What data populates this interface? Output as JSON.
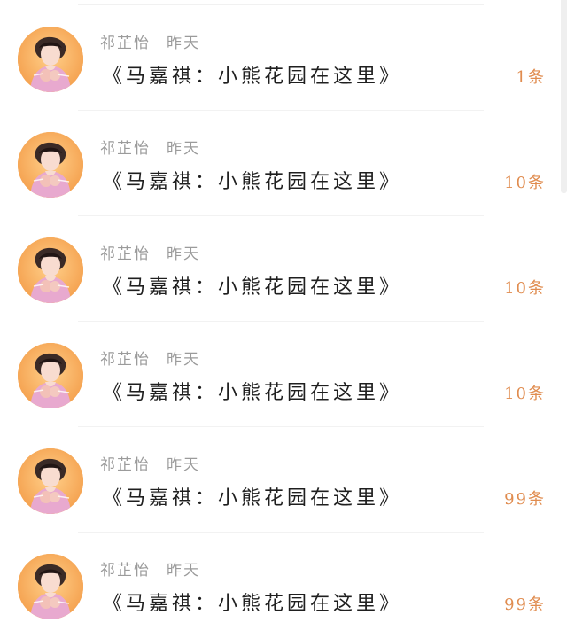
{
  "items": [
    {
      "author": "祁芷怡",
      "time": "昨天",
      "title": "《马嘉祺：小熊花园在这里》",
      "count": "1条"
    },
    {
      "author": "祁芷怡",
      "time": "昨天",
      "title": "《马嘉祺：小熊花园在这里》",
      "count": "10条"
    },
    {
      "author": "祁芷怡",
      "time": "昨天",
      "title": "《马嘉祺：小熊花园在这里》",
      "count": "10条"
    },
    {
      "author": "祁芷怡",
      "time": "昨天",
      "title": "《马嘉祺：小熊花园在这里》",
      "count": "10条"
    },
    {
      "author": "祁芷怡",
      "time": "昨天",
      "title": "《马嘉祺：小熊花园在这里》",
      "count": "99条"
    },
    {
      "author": "祁芷怡",
      "time": "昨天",
      "title": "《马嘉祺：小熊花园在这里》",
      "count": "99条"
    }
  ],
  "colors": {
    "background": "#ffffff",
    "meta_text": "#9b9b9b",
    "title_text": "#1f1f1f",
    "count_text": "#e08c4f",
    "avatar_orange": "#f5b063",
    "divider": "#f2f2f2"
  },
  "icons": {
    "avatar_image": "portrait-avatar"
  }
}
